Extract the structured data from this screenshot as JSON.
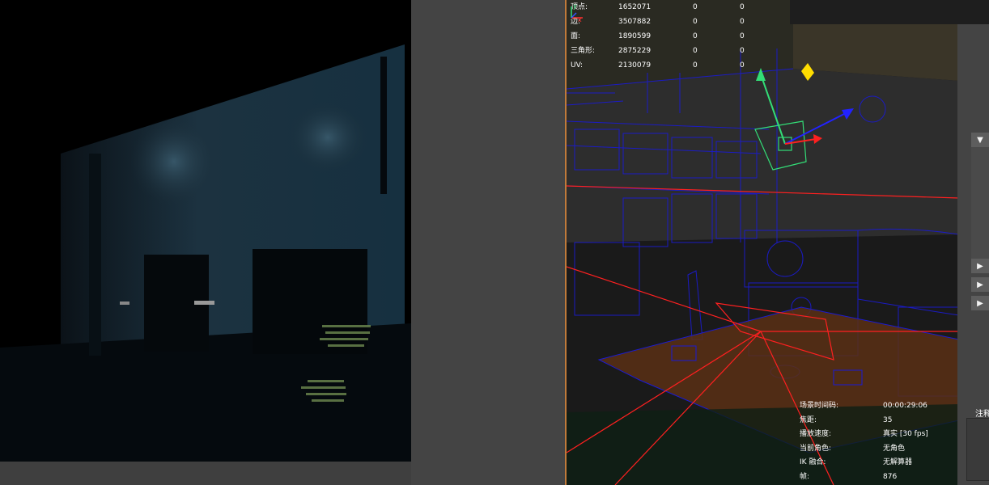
{
  "poly_stats": [
    {
      "label": "顶点:",
      "total": "1652071",
      "selected": "0",
      "extra": "0"
    },
    {
      "label": "边:",
      "total": "3507882",
      "selected": "0",
      "extra": "0"
    },
    {
      "label": "面:",
      "total": "1890599",
      "selected": "0",
      "extra": "0"
    },
    {
      "label": "三角形:",
      "total": "2875229",
      "selected": "0",
      "extra": "0"
    },
    {
      "label": "UV:",
      "total": "2130079",
      "selected": "0",
      "extra": "0"
    }
  ],
  "hud": [
    {
      "label": "场景时间码:",
      "value": "00:00:29:06"
    },
    {
      "label": "焦距:",
      "value": "35"
    },
    {
      "label": "播放速度:",
      "value": "真实 [30 fps]"
    },
    {
      "label": "当前角色:",
      "value": "无角色"
    },
    {
      "label": "IK 融合:",
      "value": "无解算器"
    },
    {
      "label": "帧:",
      "value": "876"
    }
  ],
  "axis": {
    "y": "y",
    "x": "x"
  },
  "right_panel": {
    "note_label": "注释"
  },
  "colors": {
    "wire_blue": "#1a1ad6",
    "selection_red": "#ff2020",
    "manip_green": "#33dd77",
    "manip_yellow": "#ffdd00",
    "border_orange": "#c07a3a"
  },
  "icons": [
    "chevron-down-icon",
    "play-arrow-icon"
  ]
}
